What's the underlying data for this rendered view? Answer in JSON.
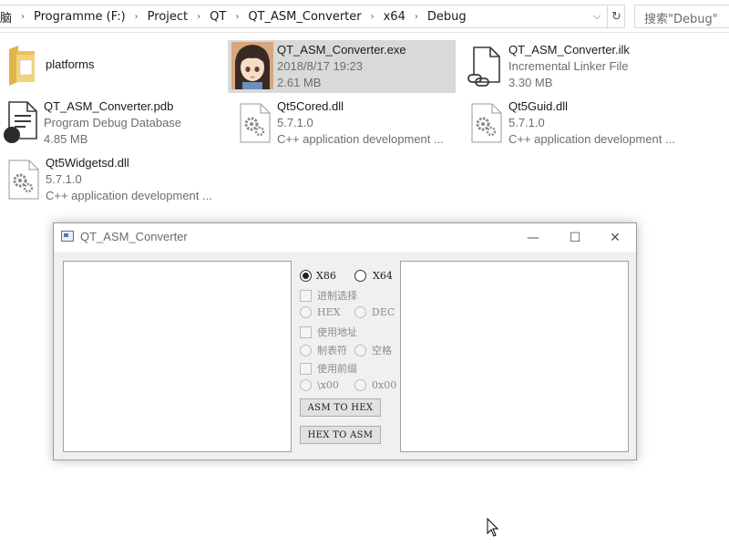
{
  "address": {
    "leading": "脑",
    "crumbs": [
      "Programme (F:)",
      "Project",
      "QT",
      "QT_ASM_Converter",
      "x64",
      "Debug"
    ],
    "separator": "›",
    "dropdown_glyph": "⌵",
    "refresh_glyph": "↻"
  },
  "search": {
    "placeholder": "搜索\"Debug\""
  },
  "files": [
    {
      "name": "platforms",
      "icon": "folder-icon"
    },
    {
      "name": "QT_ASM_Converter.exe",
      "line2": "2018/8/17 19:23",
      "line3": "2.61 MB",
      "icon": "app-avatar-icon",
      "selected": true
    },
    {
      "name": "QT_ASM_Converter.ilk",
      "line2": "Incremental Linker File",
      "line3": "3.30 MB",
      "icon": "linked-file-icon"
    },
    {
      "name": "QT_ASM_Converter.pdb",
      "line2": "Program Debug Database",
      "line3": "4.85 MB",
      "icon": "pdb-file-icon"
    },
    {
      "name": "Qt5Cored.dll",
      "line2": "5.7.1.0",
      "line3": "C++ application development ...",
      "icon": "dll-gear-icon"
    },
    {
      "name": "Qt5Guid.dll",
      "line2": "5.7.1.0",
      "line3": "C++ application development ...",
      "icon": "dll-gear-icon"
    },
    {
      "name": "Qt5Widgetsd.dll",
      "line2": "5.7.1.0",
      "line3": "C++ application development ...",
      "icon": "dll-gear-icon"
    }
  ],
  "qt_window": {
    "title": "QT_ASM_Converter",
    "minimize_glyph": "—",
    "maximize_glyph": "☐",
    "close_glyph": "✕",
    "arch": {
      "x86": "X86",
      "x64": "X64",
      "selected": "X86"
    },
    "radix_label": "进制选择",
    "hex": "HEX",
    "dec": "DEC",
    "use_address_label": "使用地址",
    "tab": "制表符",
    "space": "空格",
    "use_prefix_label": "使用前缀",
    "prefix_x00": "\\x00",
    "prefix_0x00": "0x00",
    "asm_to_hex": "ASM TO HEX",
    "hex_to_asm": "HEX TO ASM"
  }
}
